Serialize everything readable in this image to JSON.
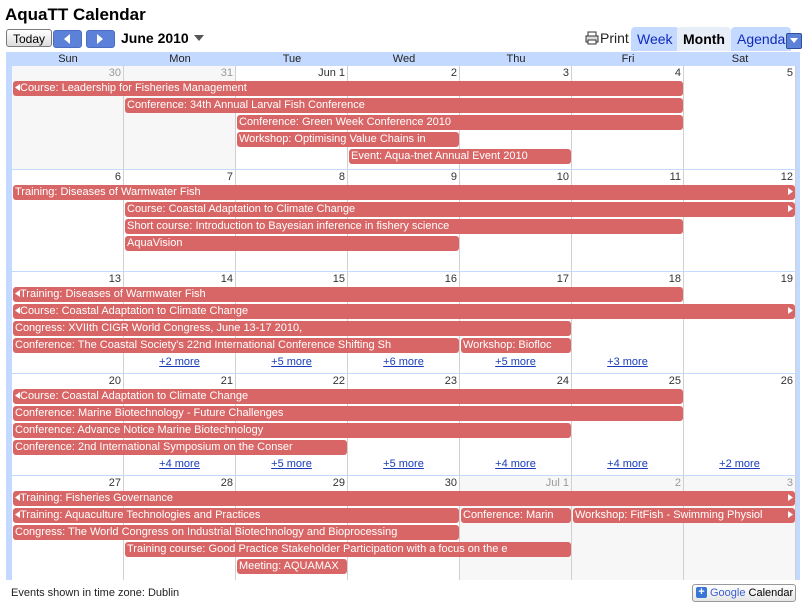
{
  "app": {
    "title": "AquaTT Calendar"
  },
  "toolbar": {
    "today": "Today",
    "period": "June 2010",
    "print": "Print",
    "tabs": {
      "week": "Week",
      "month": "Month",
      "agenda": "Agenda"
    }
  },
  "days": [
    "Sun",
    "Mon",
    "Tue",
    "Wed",
    "Thu",
    "Fri",
    "Sat"
  ],
  "weeks": [
    {
      "dates": [
        "30",
        "31",
        "Jun 1",
        "2",
        "3",
        "4",
        "5"
      ],
      "off": [
        true,
        true,
        false,
        false,
        false,
        false,
        false
      ],
      "events": [
        {
          "title": "Course: Leadership for Fisheries Management",
          "start": 0,
          "span": 6,
          "row": 0,
          "contLeft": true
        },
        {
          "title": "Conference: 34th Annual Larval Fish Conference",
          "start": 1,
          "span": 5,
          "row": 1
        },
        {
          "title": "Conference: Green Week Conference 2010",
          "start": 2,
          "span": 4,
          "row": 2
        },
        {
          "title": "Workshop: Optimising Value Chains in",
          "start": 2,
          "span": 2,
          "row": 3
        },
        {
          "title": "Event: Aqua-tnet Annual Event 2010",
          "start": 3,
          "span": 2,
          "row": 4
        }
      ],
      "more": []
    },
    {
      "dates": [
        "6",
        "7",
        "8",
        "9",
        "10",
        "11",
        "12"
      ],
      "off": [
        false,
        false,
        false,
        false,
        false,
        false,
        false
      ],
      "events": [
        {
          "title": "Training: Diseases of Warmwater Fish",
          "start": 0,
          "span": 7,
          "row": 0,
          "contRight": true
        },
        {
          "title": "Course: Coastal Adaptation to Climate Change",
          "start": 1,
          "span": 6,
          "row": 1,
          "contRight": true
        },
        {
          "title": "Short course: Introduction to Bayesian inference in fishery science",
          "start": 1,
          "span": 5,
          "row": 2
        },
        {
          "title": "AquaVision",
          "start": 1,
          "span": 3,
          "row": 3
        }
      ],
      "more": []
    },
    {
      "dates": [
        "13",
        "14",
        "15",
        "16",
        "17",
        "18",
        "19"
      ],
      "off": [
        false,
        false,
        false,
        false,
        false,
        false,
        false
      ],
      "events": [
        {
          "title": "Training: Diseases of Warmwater Fish",
          "start": 0,
          "span": 6,
          "row": 0,
          "contLeft": true
        },
        {
          "title": "Course: Coastal Adaptation to Climate Change",
          "start": 0,
          "span": 7,
          "row": 1,
          "contLeft": true,
          "contRight": true
        },
        {
          "title": "Congress: XVIIth CIGR World Congress, June 13-17 2010,",
          "start": 0,
          "span": 5,
          "row": 2
        },
        {
          "title": "Conference: The Coastal Society's 22nd International Conference Shifting Sh",
          "start": 0,
          "span": 4,
          "row": 3
        },
        {
          "title": "Workshop: Biofloc",
          "start": 4,
          "span": 1,
          "row": 3
        }
      ],
      "more": [
        {
          "col": 1,
          "text": "+2 more"
        },
        {
          "col": 2,
          "text": "+5 more"
        },
        {
          "col": 3,
          "text": "+6 more"
        },
        {
          "col": 4,
          "text": "+5 more"
        },
        {
          "col": 5,
          "text": "+3 more"
        }
      ]
    },
    {
      "dates": [
        "20",
        "21",
        "22",
        "23",
        "24",
        "25",
        "26"
      ],
      "off": [
        false,
        false,
        false,
        false,
        false,
        false,
        false
      ],
      "events": [
        {
          "title": "Course: Coastal Adaptation to Climate Change",
          "start": 0,
          "span": 6,
          "row": 0,
          "contLeft": true
        },
        {
          "title": "Conference: Marine Biotechnology - Future Challenges",
          "start": 0,
          "span": 6,
          "row": 1
        },
        {
          "title": "Conference: Advance Notice Marine Biotechnology",
          "start": 0,
          "span": 5,
          "row": 2
        },
        {
          "title": "Conference: 2nd International Symposium on the Conser",
          "start": 0,
          "span": 3,
          "row": 3
        }
      ],
      "more": [
        {
          "col": 1,
          "text": "+4 more"
        },
        {
          "col": 2,
          "text": "+5 more"
        },
        {
          "col": 3,
          "text": "+5 more"
        },
        {
          "col": 4,
          "text": "+4 more"
        },
        {
          "col": 5,
          "text": "+4 more"
        },
        {
          "col": 6,
          "text": "+2 more"
        }
      ]
    },
    {
      "dates": [
        "27",
        "28",
        "29",
        "30",
        "Jul 1",
        "2",
        "3"
      ],
      "off": [
        false,
        false,
        false,
        false,
        true,
        true,
        true
      ],
      "events": [
        {
          "title": "Training: Fisheries Governance",
          "start": 0,
          "span": 7,
          "row": 0,
          "contLeft": true,
          "contRight": true
        },
        {
          "title": "Training: Aquaculture Technologies and Practices",
          "start": 0,
          "span": 4,
          "row": 1,
          "contLeft": true
        },
        {
          "title": "Conference: Marin",
          "start": 4,
          "span": 1,
          "row": 1
        },
        {
          "title": "Workshop: FitFish - Swimming Physiol",
          "start": 5,
          "span": 2,
          "row": 1,
          "contRight": true
        },
        {
          "title": "Congress: The World Congress on Industrial Biotechnology and Bioprocessing",
          "start": 0,
          "span": 4,
          "row": 2
        },
        {
          "title": "Training course: Good Practice Stakeholder Participation with a focus on the e",
          "start": 1,
          "span": 4,
          "row": 3
        },
        {
          "title": "Meeting: AQUAMAX",
          "start": 2,
          "span": 1,
          "row": 4
        }
      ],
      "more": []
    }
  ],
  "footer": {
    "timezone": "Events shown in time zone: Dublin",
    "badge_google": "Google",
    "badge_calendar": "Calendar"
  },
  "colors": {
    "event": "#d96666",
    "grid_bg": "#c3d9ff"
  }
}
